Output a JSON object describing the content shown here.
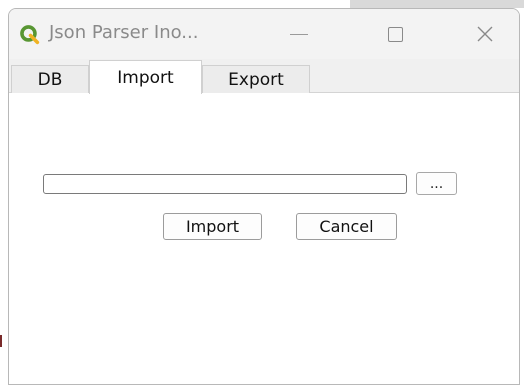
{
  "window": {
    "title": "Json Parser Ino...",
    "icon": "qgis-logo-icon",
    "accent_color": "#589632"
  },
  "tabs": [
    {
      "label": "DB",
      "active": false
    },
    {
      "label": "Import",
      "active": true
    },
    {
      "label": "Export",
      "active": false
    }
  ],
  "import_panel": {
    "path_value": "",
    "browse_label": "...",
    "import_label": "Import",
    "cancel_label": "Cancel"
  }
}
